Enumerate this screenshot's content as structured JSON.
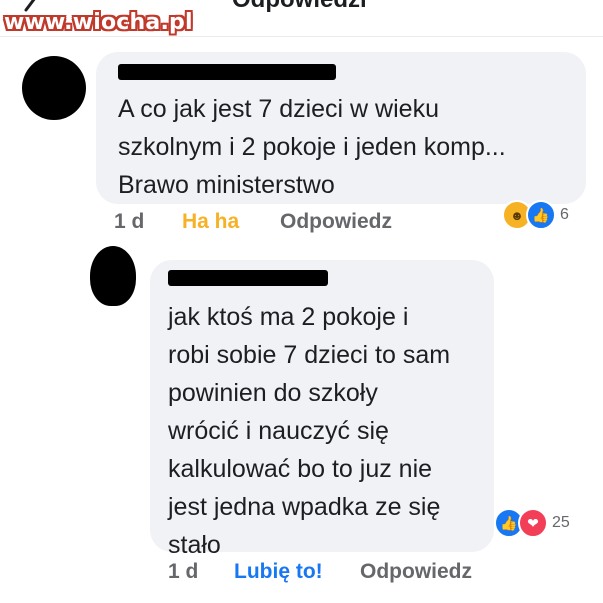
{
  "watermark": "www.wiocha.pl",
  "header": {
    "title": "Odpowiedzi"
  },
  "comments": [
    {
      "text": "A co jak jest 7 dzieci w wieku\nszkolnym i 2 pokoje i jeden komp...\nBrawo ministerstwo",
      "time": "1 d",
      "reaction_action": "Ha ha",
      "reply_label": "Odpowiedz",
      "reactions": {
        "icons": [
          "haha",
          "like"
        ],
        "count": "6"
      }
    },
    {
      "text": "jak ktoś ma 2 pokoje i\nrobi sobie 7 dzieci to sam\npowinien do szkoły\nwrócić i nauczyć się\nkalkulować bo to juz nie\njest jedna wpadka ze się\nstało",
      "time": "1 d",
      "reaction_action": "Lubię to!",
      "reply_label": "Odpowiedz",
      "reactions": {
        "icons": [
          "like",
          "love"
        ],
        "count": "25"
      }
    }
  ],
  "colors": {
    "like_blue": "#1877f2",
    "haha_yellow": "#f7b125",
    "love_red": "#f33e58",
    "bubble_gray": "#f0f2f5"
  }
}
